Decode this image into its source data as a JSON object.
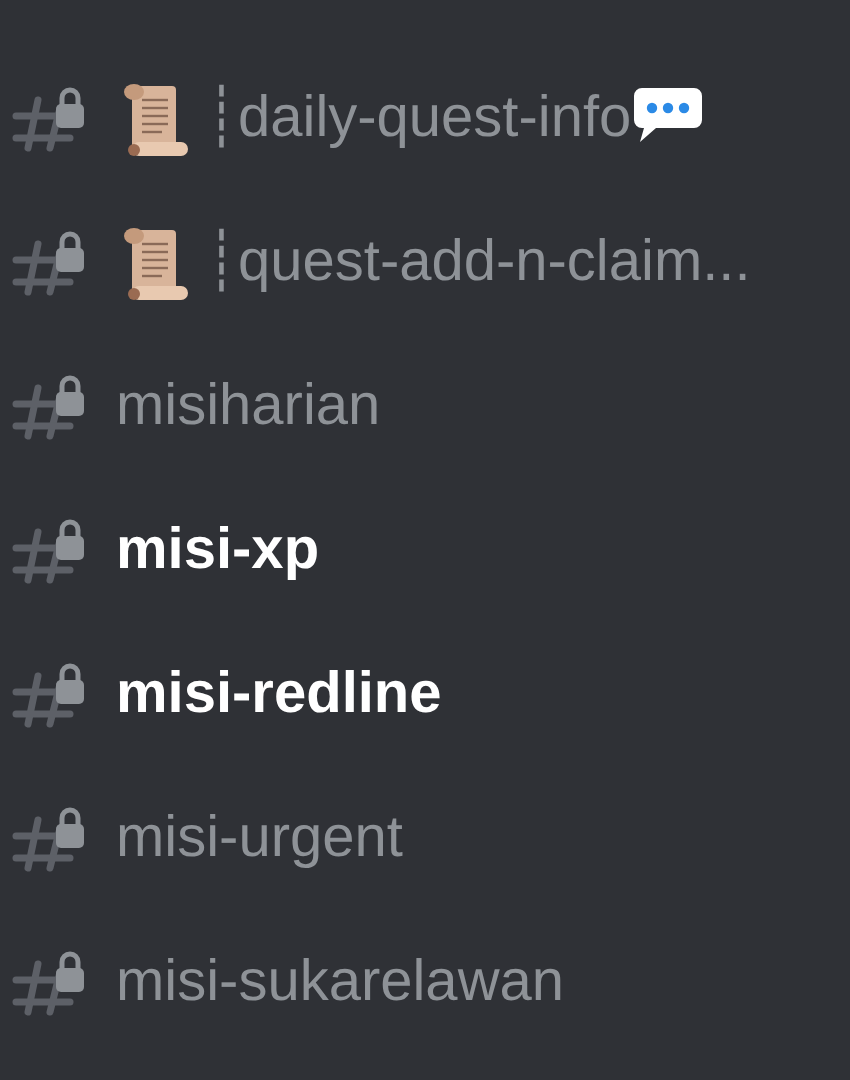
{
  "channels": [
    {
      "name": "┊daily-quest-info",
      "scroll_emoji": true,
      "speech_bubble": true,
      "unread": false
    },
    {
      "name": "┊quest-add-n-claim...",
      "scroll_emoji": true,
      "speech_bubble": false,
      "unread": false
    },
    {
      "name": "misiharian",
      "scroll_emoji": false,
      "speech_bubble": false,
      "unread": false
    },
    {
      "name": "misi-xp",
      "scroll_emoji": false,
      "speech_bubble": false,
      "unread": true
    },
    {
      "name": "misi-redline",
      "scroll_emoji": false,
      "speech_bubble": false,
      "unread": true
    },
    {
      "name": "misi-urgent",
      "scroll_emoji": false,
      "speech_bubble": false,
      "unread": false
    },
    {
      "name": "misi-sukarelawan",
      "scroll_emoji": false,
      "speech_bubble": false,
      "unread": false
    }
  ]
}
